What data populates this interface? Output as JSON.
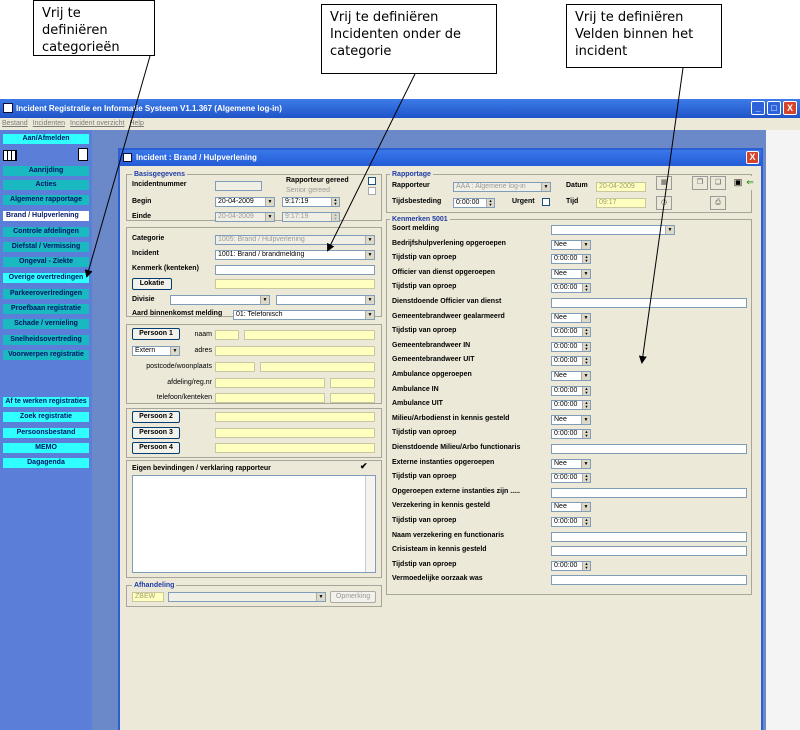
{
  "callouts": [
    {
      "lines": [
        "Vrij te definiëren",
        "categorieën"
      ]
    },
    {
      "lines": [
        "Vrij te definiëren",
        "Incidenten onder de",
        "categorie"
      ]
    },
    {
      "lines": [
        "Vrij te definiëren",
        "Velden binnen het",
        "incident"
      ]
    }
  ],
  "main_window": {
    "title": "Incident Registratie en Informatie Systeem V1.1.367  (Algemene log-in)",
    "menu": [
      "Bestand",
      "Incidenten",
      "Incident overzicht",
      "Help"
    ],
    "buttons": {
      "minimize": "_",
      "maximize": "□",
      "close": "X"
    }
  },
  "sidebar": {
    "login": "Aan/Afmelden",
    "categories": [
      "Aanrijding",
      "Acties",
      "Algemene rapportage",
      "Brand / Hulpverlening",
      "Controle afdelingen",
      "Diefstal / Vermissing",
      "Ongeval - Ziekte",
      "Overige overtredingen",
      "Parkeeroverlredingen",
      "Proefbaan registratie",
      "Schade / vernieling",
      "Snelheidsovertreding",
      "Voorwerpen registratie"
    ],
    "actions": [
      "Af te werken registraties",
      "Zoek registratie",
      "Persoonsbestand",
      "MEMO",
      "Dagagenda"
    ]
  },
  "dialog": {
    "title": "Incident : Brand / Hulpverlening",
    "close": "X",
    "basisgegevens": {
      "section": "Basisgegevens",
      "incidentnummer_label": "Incidentnummer",
      "rapporteur_gereed": "Rapporteur gereed",
      "senior_gereed": "Senior gereed",
      "begin_label": "Begin",
      "begin_date": "20-04-2009",
      "begin_time": "9:17:19",
      "einde_label": "Einde",
      "einde_date": "20-04-2009",
      "einde_time": "9:17:19"
    },
    "incident_info": {
      "categorie_label": "Categorie",
      "categorie_value": "1005: Brand / Hulpverlening",
      "incident_label": "Incident",
      "incident_value": "1001: Brand / brandmelding",
      "kenmerk_label": "Kenmerk (kenteken)",
      "lokatie_button": "Lokatie",
      "divisie_label": "Divisie",
      "aard_label": "Aard binnenkomst melding",
      "aard_value": "01: Telefonisch"
    },
    "persons": {
      "persoon1": "Persoon 1",
      "naam_label": "naam",
      "type_value": "Extern",
      "adres_label": "adres",
      "postcode_label": "postcode/woonplaats",
      "afdeling_label": "afdeling/reg.nr",
      "telefoon_label": "telefoon/kenteken",
      "persoon2": "Persoon 2",
      "persoon3": "Persoon 3",
      "persoon4": "Persoon 4"
    },
    "bevindingen_label": "Eigen bevindingen / verklaring rapporteur",
    "afhandeling": {
      "section": "Afhandeling",
      "code": "ZBEW",
      "opmerking_button": "Opmerking"
    },
    "rapportage": {
      "section": "Rapportage",
      "rapporteur_label": "Rapporteur",
      "rapporteur_value": "AAA : Algemene log-in",
      "datum_label": "Datum",
      "datum_value": "20-04-2009",
      "tijdsbesteding_label": "Tijdsbesteding",
      "tijdsbesteding_value": "0:00:00",
      "urgent_label": "Urgent",
      "tijd_label": "Tijd",
      "tijd_value": "09:17"
    },
    "kenmerken": {
      "section": "Kenmerken 5001",
      "fields": [
        {
          "label": "Soort melding",
          "type": "select-wide",
          "value": ""
        },
        {
          "label": "Bedrijfshulpverlening opgeroepen",
          "type": "select",
          "value": "Nee"
        },
        {
          "label": "Tijdstip van oproep",
          "type": "time",
          "value": "0:00:00"
        },
        {
          "label": "Officier van dienst opgeroepen",
          "type": "select",
          "value": "Nee"
        },
        {
          "label": "Tijdstip van oproep",
          "type": "time",
          "value": "0:00:00"
        },
        {
          "label": "Dienstdoende Officier van dienst",
          "type": "text",
          "value": ""
        },
        {
          "label": "Gemeentebrandweer gealarmeerd",
          "type": "select",
          "value": "Nee"
        },
        {
          "label": "Tijdstip van oproep",
          "type": "time",
          "value": "0:00:00"
        },
        {
          "label": "Gemeentebrandweer IN",
          "type": "time",
          "value": "0:00:00"
        },
        {
          "label": "Gemeentebrandweer UIT",
          "type": "time",
          "value": "0:00:00"
        },
        {
          "label": "Ambulance opgeroepen",
          "type": "select",
          "value": "Nee"
        },
        {
          "label": "Ambulance IN",
          "type": "time",
          "value": "0:00:00"
        },
        {
          "label": "Ambulance UIT",
          "type": "time",
          "value": "0:00:00"
        },
        {
          "label": "Milieu/Arbodienst in kennis gesteld",
          "type": "select",
          "value": "Nee"
        },
        {
          "label": "Tijdstip van oproep",
          "type": "time",
          "value": "0:00:00"
        },
        {
          "label": "Dienstdoende Milieu/Arbo functionaris",
          "type": "text",
          "value": ""
        },
        {
          "label": "Externe instanties opgeroepen",
          "type": "select",
          "value": "Nee"
        },
        {
          "label": "Tijdstip van oproep",
          "type": "time",
          "value": "0:00:00"
        },
        {
          "label": "Opgeroepen externe instanties zijn .....",
          "type": "text",
          "value": ""
        },
        {
          "label": "Verzekering in kennis gesteld",
          "type": "select",
          "value": "Nee"
        },
        {
          "label": "Tijdstip van oproep",
          "type": "time",
          "value": "0:00:00"
        },
        {
          "label": "Naam verzekering en functionaris",
          "type": "text",
          "value": ""
        },
        {
          "label": "Crisisteam in kennis gesteld",
          "type": "text",
          "value": ""
        },
        {
          "label": "Tijdstip van oproep",
          "type": "time",
          "value": "0:00:00"
        },
        {
          "label": "Vermoedelijke oorzaak was",
          "type": "text",
          "value": ""
        }
      ]
    }
  }
}
